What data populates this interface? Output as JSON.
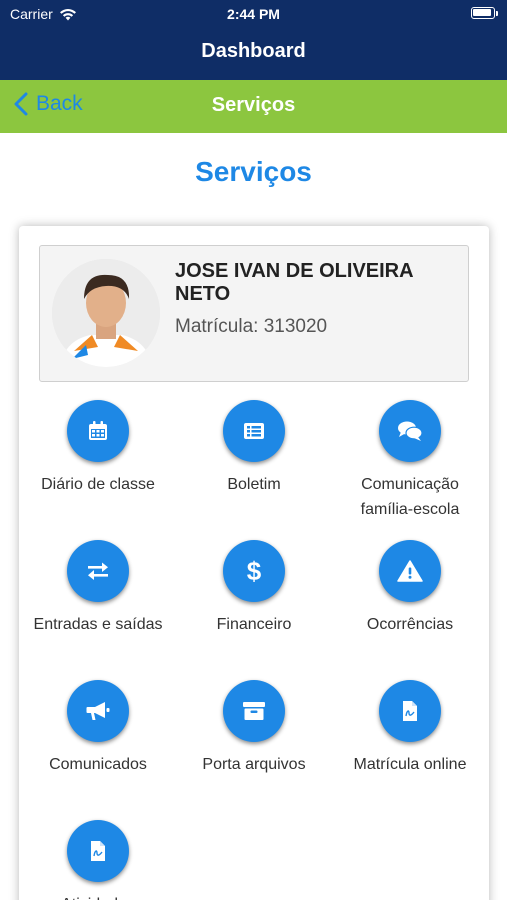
{
  "status_bar": {
    "carrier": "Carrier",
    "time": "2:44 PM"
  },
  "header": {
    "title": "Dashboard"
  },
  "nav": {
    "back_label": "Back",
    "title": "Serviços"
  },
  "page": {
    "title": "Serviços"
  },
  "profile": {
    "name": "JOSE IVAN DE OLIVEIRA NETO",
    "registration": "Matrícula: 313020"
  },
  "services": [
    {
      "label": "Diário de classe",
      "icon": "calendar-icon"
    },
    {
      "label": "Boletim",
      "icon": "list-icon"
    },
    {
      "label": "Comunicação família-escola",
      "icon": "chat-icon"
    },
    {
      "label": "Entradas e saídas",
      "icon": "exchange-icon"
    },
    {
      "label": "Financeiro",
      "icon": "dollar-icon"
    },
    {
      "label": "Ocorrências",
      "icon": "warning-icon"
    },
    {
      "label": "Comunicados",
      "icon": "megaphone-icon"
    },
    {
      "label": "Porta arquivos",
      "icon": "archive-icon"
    },
    {
      "label": "Matrícula online",
      "icon": "document-icon"
    },
    {
      "label": "Atividades",
      "icon": "document-icon"
    }
  ],
  "colors": {
    "header_bg": "#0f2d66",
    "nav_bg": "#8cc63f",
    "accent": "#1e88e5"
  }
}
